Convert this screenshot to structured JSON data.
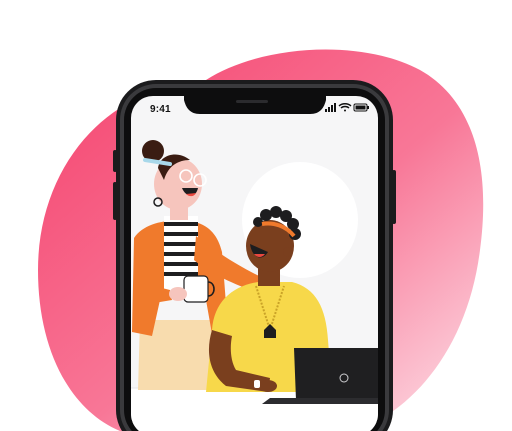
{
  "status_bar": {
    "time": "9:41",
    "signal_icon": "cellular-signal-icon",
    "wifi_icon": "wifi-icon",
    "battery_icon": "battery-icon"
  },
  "colors": {
    "blob_start": "#f5436e",
    "blob_end": "#fde3ea",
    "phone_frame": "#1b1b1d",
    "screen_bg": "#f6f6f7",
    "orange_jacket": "#f07a2c",
    "yellow_shirt": "#f7d84a",
    "skin_light": "#f6c5bd",
    "skin_dark": "#7a3f1e",
    "laptop": "#1f1f21"
  },
  "illustration": {
    "description_icons": [
      "woman-with-mug-figure",
      "man-with-laptop-figure",
      "laptop-icon"
    ]
  }
}
